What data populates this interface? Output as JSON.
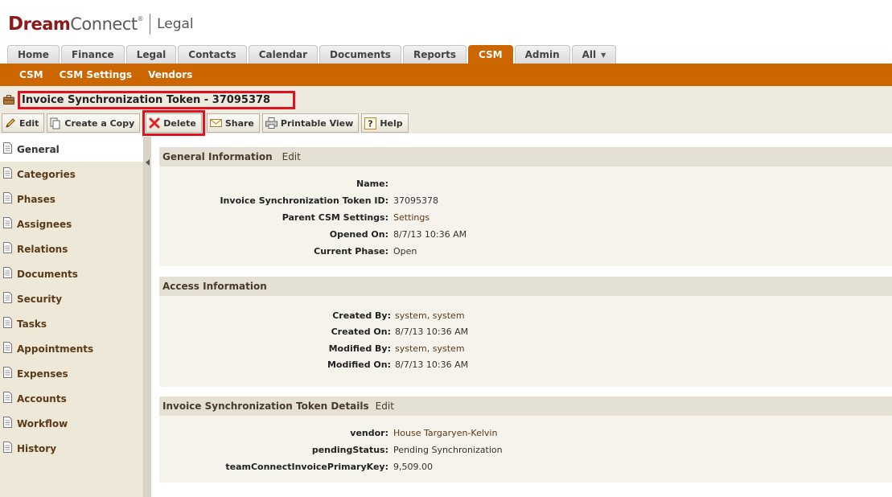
{
  "brand": {
    "name_prefix": "D",
    "name_dream": "ream",
    "name_connect": "Connect",
    "trademark": "®",
    "product": "Legal"
  },
  "tabs": [
    {
      "label": "Home"
    },
    {
      "label": "Finance"
    },
    {
      "label": "Legal"
    },
    {
      "label": "Contacts"
    },
    {
      "label": "Calendar"
    },
    {
      "label": "Documents"
    },
    {
      "label": "Reports"
    },
    {
      "label": "CSM",
      "active": true
    },
    {
      "label": "Admin"
    },
    {
      "label": "All"
    }
  ],
  "subnav": [
    {
      "label": "CSM"
    },
    {
      "label": "CSM Settings"
    },
    {
      "label": "Vendors"
    }
  ],
  "record": {
    "title": "Invoice Synchronization Token - 37095378"
  },
  "toolbar": {
    "edit": "Edit",
    "copy": "Create a Copy",
    "delete": "Delete",
    "share": "Share",
    "print": "Printable View",
    "help": "Help"
  },
  "sidebar": {
    "items": [
      {
        "label": "General",
        "active": true
      },
      {
        "label": "Categories"
      },
      {
        "label": "Phases"
      },
      {
        "label": "Assignees"
      },
      {
        "label": "Relations"
      },
      {
        "label": "Documents"
      },
      {
        "label": "Security"
      },
      {
        "label": "Tasks"
      },
      {
        "label": "Appointments"
      },
      {
        "label": "Expenses"
      },
      {
        "label": "Accounts"
      },
      {
        "label": "Workflow"
      },
      {
        "label": "History"
      }
    ]
  },
  "general": {
    "title": "General Information",
    "edit": "Edit",
    "fields": [
      {
        "label": "Name:",
        "value": ""
      },
      {
        "label": "Invoice Synchronization Token ID:",
        "value": "37095378"
      },
      {
        "label": "Parent CSM Settings:",
        "value": "Settings"
      },
      {
        "label": "Opened On:",
        "value": "8/7/13 10:36 AM"
      },
      {
        "label": "Current Phase:",
        "value": "Open"
      }
    ]
  },
  "access": {
    "title": "Access Information",
    "fields": [
      {
        "label": "Created By:",
        "value": "system, system"
      },
      {
        "label": "Created On:",
        "value": "8/7/13 10:36 AM"
      },
      {
        "label": "Modified By:",
        "value": "system, system"
      },
      {
        "label": "Modified On:",
        "value": "8/7/13 10:36 AM"
      }
    ]
  },
  "details": {
    "title": "Invoice Synchronization Token Details",
    "edit": "Edit",
    "fields": [
      {
        "label": "vendor:",
        "value": "House Targaryen-Kelvin"
      },
      {
        "label": "pendingStatus:",
        "value": "Pending Synchronization"
      },
      {
        "label": "teamConnectInvoicePrimaryKey:",
        "value": "9,509.00"
      }
    ]
  },
  "colors": {
    "accent": "#cc6600",
    "highlight": "#e1111e",
    "brand": "#8b1a1a"
  }
}
